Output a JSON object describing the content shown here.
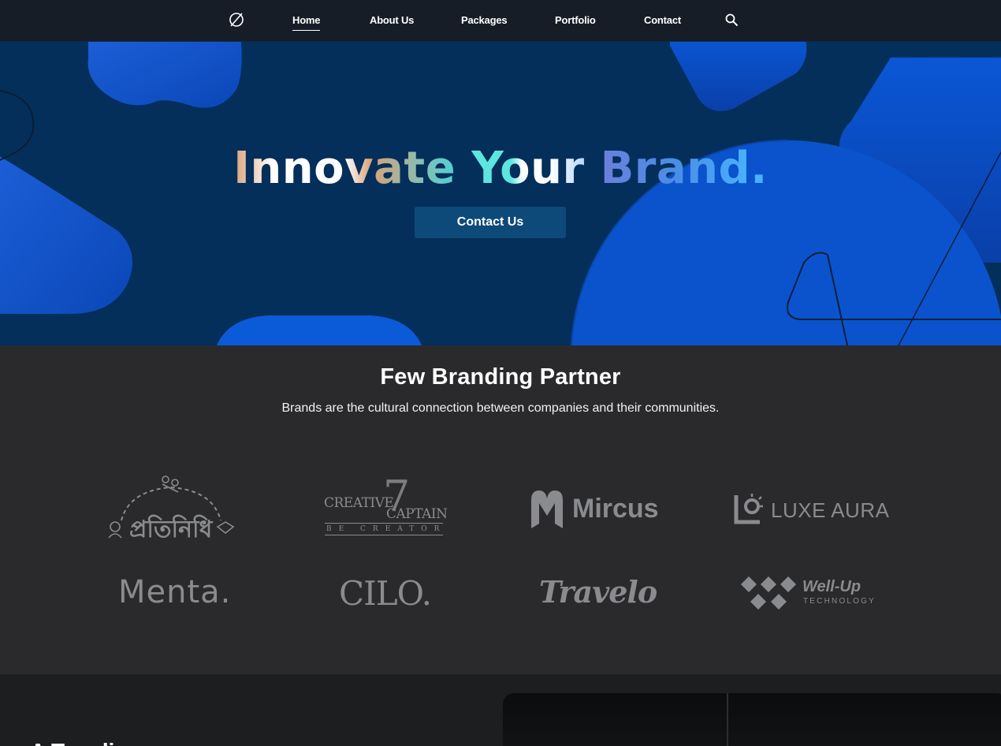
{
  "nav": {
    "logo_icon": "empty-set-logo",
    "items": [
      {
        "label": "Home",
        "active": true
      },
      {
        "label": "About Us",
        "active": false
      },
      {
        "label": "Packages",
        "active": false
      },
      {
        "label": "Portfolio",
        "active": false
      },
      {
        "label": "Contact",
        "active": false
      }
    ],
    "search_icon": "search-icon"
  },
  "hero": {
    "title_part1": "Innovate",
    "title_part2": "Your",
    "title_part3": "Brand",
    "title_dot": ".",
    "cta_label": "Contact Us",
    "background_color": "#032f5a",
    "shape_color": "#0b5bd6"
  },
  "partners": {
    "title": "Few Branding Partner",
    "subtitle": "Brands are the cultural connection between companies and their communities.",
    "logos": [
      {
        "name": "প্রতিনিধি"
      },
      {
        "name": "CREATIVE",
        "name2": "CAPTAIN",
        "mark": "7",
        "tagline": "BE CREATOR"
      },
      {
        "name": "Mircus"
      },
      {
        "name": "LUXE AURA"
      },
      {
        "name": "Menta."
      },
      {
        "name": "CILO."
      },
      {
        "name": "Travelo"
      },
      {
        "name": "Well-Up",
        "tagline": "TECHNOLOGY"
      }
    ],
    "logo_color": "#8a8b8e"
  },
  "next_section": {
    "heading_fragment": "A Toy di"
  }
}
